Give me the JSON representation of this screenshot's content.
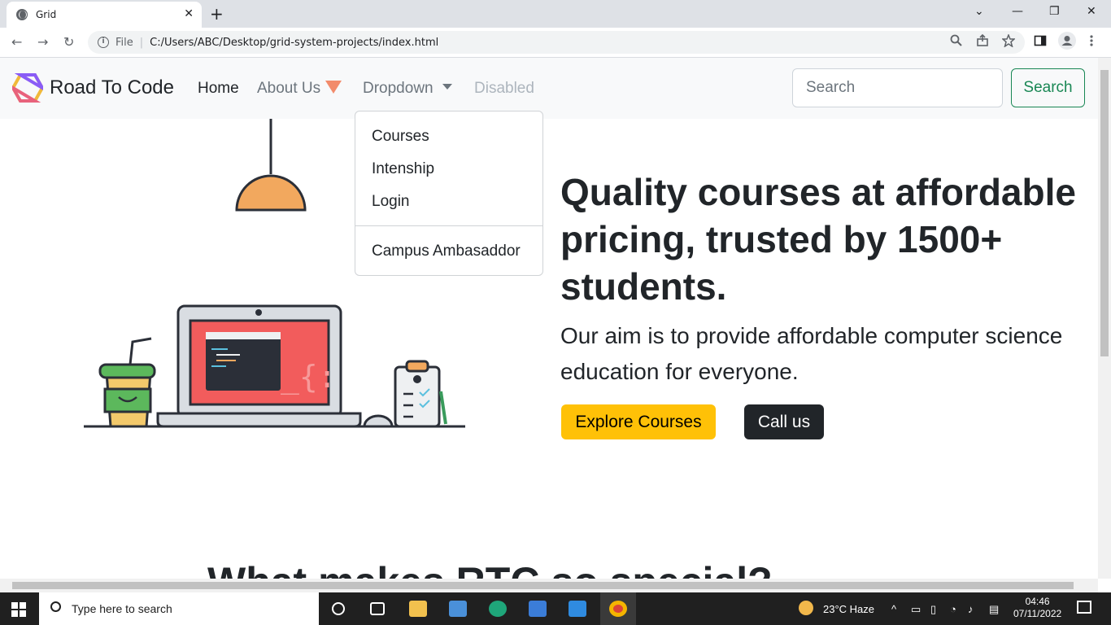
{
  "browser": {
    "tab_title": "Grid",
    "tab_close": "✕",
    "new_tab": "+",
    "window_controls": [
      "⌄",
      "—",
      "❐",
      "✕"
    ],
    "address_prefix": "File",
    "address_url": "C:/Users/ABC/Desktop/grid-system-projects/index.html",
    "icons": [
      "info-icon",
      "zoom-icon",
      "share-icon",
      "star-icon",
      "sidepanel-icon",
      "profile-icon",
      "menu-icon"
    ]
  },
  "navbar": {
    "brand": "Road To Code",
    "links": [
      "Home",
      "About Us",
      "Dropdown",
      "Disabled"
    ],
    "search_placeholder": "Search",
    "search_button": "Search"
  },
  "dropdown": {
    "items": [
      "Courses",
      "Intenship",
      "Login"
    ],
    "after_divider": "Campus Ambasaddor"
  },
  "hero": {
    "title": "Quality courses at affordable pricing, trusted by 1500+ students.",
    "subtitle": "Our aim is to provide affordable computer science education for everyone.",
    "explore_button": "Explore Courses",
    "call_button": "Call us"
  },
  "section": {
    "heading": "What makes RTC so special?"
  },
  "taskbar": {
    "search_placeholder": "Type here to search",
    "weather": "23°C  Haze",
    "time": "04:46",
    "date": "07/11/2022"
  },
  "colors": {
    "warning": "#ffc107",
    "dark": "#212529",
    "success": "#198754",
    "caret": "#f28b6b"
  }
}
